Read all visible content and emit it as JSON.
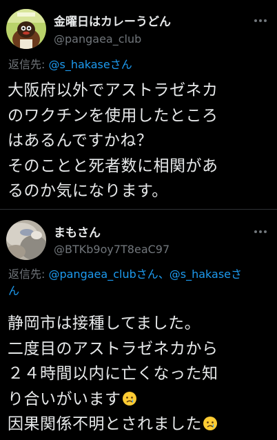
{
  "tweets": [
    {
      "display_name": "金曜日はカレーうどん",
      "handle": "@pangaea_club",
      "reply_prefix": "返信先: ",
      "reply_mention_1": "@s_hakase",
      "reply_suffix_1": "さん",
      "body_lines": [
        "大阪府以外でアストラゼネカ",
        "のワクチンを使用したところ",
        "はあるんですかね？",
        "そのことと死者数に相関があ",
        "るのか気になります。"
      ]
    },
    {
      "display_name": "まもさん",
      "handle": "@BTKb9oy7T8eaC97",
      "reply_prefix": "返信先: ",
      "reply_mention_1": "@pangaea_club",
      "reply_suffix_1": "さん、",
      "reply_mention_2": "@s_hakase",
      "reply_suffix_2": "さ",
      "reply_line_2": "ん",
      "body_lines": [
        "静岡市は接種してました。",
        "二度目のアストラゼネカから",
        "２４時間以内に亡くなった知",
        "り合いがいます",
        "因果関係不明とされました"
      ],
      "emoji": "crying-face"
    }
  ],
  "more_icon": "more-options-icon",
  "colors": {
    "background": "#000000",
    "text": "#e7e9ea",
    "secondary": "#71767b",
    "link": "#1d9bf0",
    "divider": "#2f3336"
  }
}
